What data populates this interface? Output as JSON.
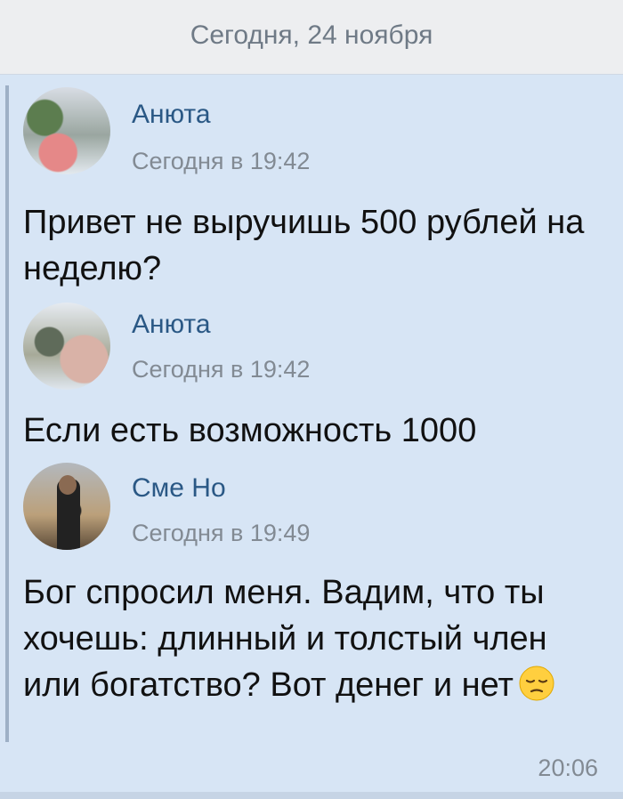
{
  "date_header": "Сегодня, 24 ноября",
  "messages": [
    {
      "sender": "Анюта",
      "time": "Сегодня в 19:42",
      "text": "Привет не выручишь 500 рублей на неделю?"
    },
    {
      "sender": "Анюта",
      "time": "Сегодня в 19:42",
      "text": "Если есть возможность 1000"
    },
    {
      "sender": "Сме Но",
      "time": "Сегодня в 19:49",
      "text": "Бог спросил меня. Вадим, что ты хочешь: длинный и толстый член или богатство? Вот денег и нет",
      "emoji": "pensive-face"
    }
  ],
  "footer_time": "20:06",
  "colors": {
    "background": "#d7e5f5",
    "header_bg": "#edeef0",
    "name": "#2a5885",
    "meta": "#828a93"
  }
}
